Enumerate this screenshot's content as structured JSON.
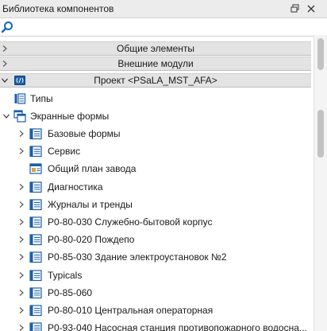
{
  "panel": {
    "title": "Библиотека компонентов",
    "pin_icon": "pin-icon",
    "close_icon": "close-icon"
  },
  "search": {
    "icon": "search-icon",
    "value": "",
    "placeholder": ""
  },
  "sections": [
    {
      "label": "Общие элементы",
      "icon": "chevron-right-icon",
      "expanded": false
    },
    {
      "label": "Внешние модули",
      "icon": "chevron-right-icon",
      "expanded": false
    },
    {
      "label": "Проект <PSaLA_MST_AFA>",
      "icon": "chevron-down-icon",
      "expanded": true,
      "item_icon": "project-icon"
    }
  ],
  "tree": {
    "types": {
      "label": "Типы",
      "icon": "types-icon"
    },
    "screen_forms": {
      "label": "Экранные формы",
      "icon": "screen-forms-icon",
      "expanded": true,
      "children": [
        {
          "label": "Базовые формы",
          "icon": "folder-form-icon",
          "expandable": true
        },
        {
          "label": "Сервис",
          "icon": "folder-form-icon",
          "expandable": true
        },
        {
          "label": "Общий план завода",
          "icon": "screen-form-icon",
          "expandable": false
        },
        {
          "label": "Диагностика",
          "icon": "folder-form-icon",
          "expandable": true
        },
        {
          "label": "Журналы и тренды",
          "icon": "folder-form-icon",
          "expandable": true
        },
        {
          "label": "Р0-80-030 Служебно-бытовой корпус",
          "icon": "folder-form-icon",
          "expandable": true
        },
        {
          "label": "Р0-80-020 Пождепо",
          "icon": "folder-form-icon",
          "expandable": true
        },
        {
          "label": "Р0-85-030 Здание электроустановок №2",
          "icon": "folder-form-icon",
          "expandable": true
        },
        {
          "label": "Typicals",
          "icon": "folder-form-icon",
          "expandable": true
        },
        {
          "label": "Р0-85-060",
          "icon": "folder-form-icon",
          "expandable": true
        },
        {
          "label": "Р0-80-010 Центральная операторная",
          "icon": "folder-form-icon",
          "expandable": true
        },
        {
          "label": "Р0-93-040 Насосная станция противопожарного водосна...",
          "icon": "folder-form-icon",
          "expandable": true
        }
      ]
    }
  },
  "colors": {
    "titlebar_bg": "#ececec",
    "section_bg": "#e3e3e3",
    "icon_blue": "#1c5fa8",
    "search_blue": "#1565c0",
    "chevron_gray": "#5a5a5a"
  }
}
